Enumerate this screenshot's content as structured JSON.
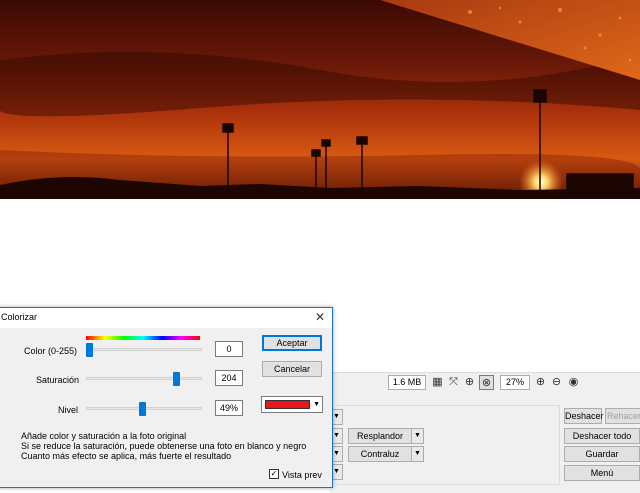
{
  "dialog": {
    "title": "Colorizar",
    "close_symbol": "✕",
    "color_label": "Color (0-255)",
    "color_value": "0",
    "color_fraction": 0.0,
    "saturation_label": "Saturación",
    "saturation_value": "204",
    "saturation_fraction": 0.8,
    "level_label": "Nivel",
    "level_value": "49%",
    "level_fraction": 0.49,
    "accept_label": "Aceptar",
    "cancel_label": "Cancelar",
    "selected_color": "#e8171b",
    "description": [
      "Añade color y saturación a la foto original",
      "Si se reduce la saturación, puede obtenerse una foto en blanco y negro",
      "Cuanto más efecto se aplica, más fuerte el resultado"
    ],
    "preview_label": "Vista previa",
    "preview_checked": true
  },
  "toolbar": {
    "file_size": "1.6 MB",
    "zoom": "27%",
    "icons": [
      "checker-icon",
      "fit-icon",
      "zoom-100-icon",
      "zoom-fit-icon",
      "zoom-in-icon",
      "zoom-out-icon",
      "info-icon"
    ]
  },
  "panel": {
    "resplandor_label": "Resplandor",
    "contraste_label": "Contraluz",
    "undo_label": "Deshacer",
    "redo_label": "Rehacer",
    "undo_all_label": "Deshacer todo",
    "save_label": "Guardar",
    "menu_label": "Menú"
  },
  "colors": {
    "accent": "#0078d7",
    "dialog_border": "#1a73c9"
  }
}
